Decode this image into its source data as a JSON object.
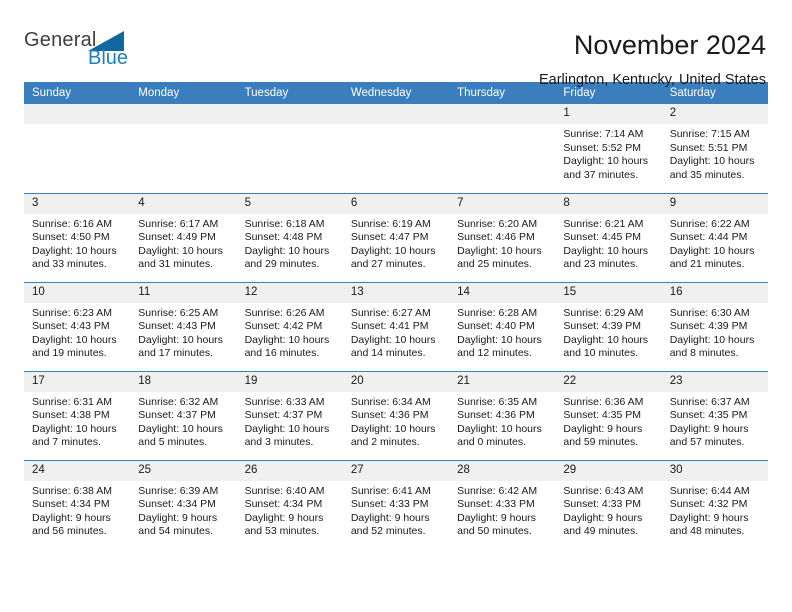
{
  "logo": {
    "word_top": "General",
    "word_bottom": "Blue",
    "mark": "blue-triangle-flag",
    "color_top": "#3f3f3f",
    "color_bottom": "#1b7fc4"
  },
  "header": {
    "month_title": "November 2024",
    "location": "Earlington, Kentucky, United States"
  },
  "theme": {
    "header_blue": "#3b7ebe",
    "daynum_gray": "#f0f0f0",
    "text": "#1a1a1a"
  },
  "weekday_headers": [
    "Sunday",
    "Monday",
    "Tuesday",
    "Wednesday",
    "Thursday",
    "Friday",
    "Saturday"
  ],
  "weeks": [
    [
      {
        "day": "",
        "sunrise": "",
        "sunset": "",
        "daylight": ""
      },
      {
        "day": "",
        "sunrise": "",
        "sunset": "",
        "daylight": ""
      },
      {
        "day": "",
        "sunrise": "",
        "sunset": "",
        "daylight": ""
      },
      {
        "day": "",
        "sunrise": "",
        "sunset": "",
        "daylight": ""
      },
      {
        "day": "",
        "sunrise": "",
        "sunset": "",
        "daylight": ""
      },
      {
        "day": "1",
        "sunrise": "Sunrise: 7:14 AM",
        "sunset": "Sunset: 5:52 PM",
        "daylight": "Daylight: 10 hours and 37 minutes."
      },
      {
        "day": "2",
        "sunrise": "Sunrise: 7:15 AM",
        "sunset": "Sunset: 5:51 PM",
        "daylight": "Daylight: 10 hours and 35 minutes."
      }
    ],
    [
      {
        "day": "3",
        "sunrise": "Sunrise: 6:16 AM",
        "sunset": "Sunset: 4:50 PM",
        "daylight": "Daylight: 10 hours and 33 minutes."
      },
      {
        "day": "4",
        "sunrise": "Sunrise: 6:17 AM",
        "sunset": "Sunset: 4:49 PM",
        "daylight": "Daylight: 10 hours and 31 minutes."
      },
      {
        "day": "5",
        "sunrise": "Sunrise: 6:18 AM",
        "sunset": "Sunset: 4:48 PM",
        "daylight": "Daylight: 10 hours and 29 minutes."
      },
      {
        "day": "6",
        "sunrise": "Sunrise: 6:19 AM",
        "sunset": "Sunset: 4:47 PM",
        "daylight": "Daylight: 10 hours and 27 minutes."
      },
      {
        "day": "7",
        "sunrise": "Sunrise: 6:20 AM",
        "sunset": "Sunset: 4:46 PM",
        "daylight": "Daylight: 10 hours and 25 minutes."
      },
      {
        "day": "8",
        "sunrise": "Sunrise: 6:21 AM",
        "sunset": "Sunset: 4:45 PM",
        "daylight": "Daylight: 10 hours and 23 minutes."
      },
      {
        "day": "9",
        "sunrise": "Sunrise: 6:22 AM",
        "sunset": "Sunset: 4:44 PM",
        "daylight": "Daylight: 10 hours and 21 minutes."
      }
    ],
    [
      {
        "day": "10",
        "sunrise": "Sunrise: 6:23 AM",
        "sunset": "Sunset: 4:43 PM",
        "daylight": "Daylight: 10 hours and 19 minutes."
      },
      {
        "day": "11",
        "sunrise": "Sunrise: 6:25 AM",
        "sunset": "Sunset: 4:43 PM",
        "daylight": "Daylight: 10 hours and 17 minutes."
      },
      {
        "day": "12",
        "sunrise": "Sunrise: 6:26 AM",
        "sunset": "Sunset: 4:42 PM",
        "daylight": "Daylight: 10 hours and 16 minutes."
      },
      {
        "day": "13",
        "sunrise": "Sunrise: 6:27 AM",
        "sunset": "Sunset: 4:41 PM",
        "daylight": "Daylight: 10 hours and 14 minutes."
      },
      {
        "day": "14",
        "sunrise": "Sunrise: 6:28 AM",
        "sunset": "Sunset: 4:40 PM",
        "daylight": "Daylight: 10 hours and 12 minutes."
      },
      {
        "day": "15",
        "sunrise": "Sunrise: 6:29 AM",
        "sunset": "Sunset: 4:39 PM",
        "daylight": "Daylight: 10 hours and 10 minutes."
      },
      {
        "day": "16",
        "sunrise": "Sunrise: 6:30 AM",
        "sunset": "Sunset: 4:39 PM",
        "daylight": "Daylight: 10 hours and 8 minutes."
      }
    ],
    [
      {
        "day": "17",
        "sunrise": "Sunrise: 6:31 AM",
        "sunset": "Sunset: 4:38 PM",
        "daylight": "Daylight: 10 hours and 7 minutes."
      },
      {
        "day": "18",
        "sunrise": "Sunrise: 6:32 AM",
        "sunset": "Sunset: 4:37 PM",
        "daylight": "Daylight: 10 hours and 5 minutes."
      },
      {
        "day": "19",
        "sunrise": "Sunrise: 6:33 AM",
        "sunset": "Sunset: 4:37 PM",
        "daylight": "Daylight: 10 hours and 3 minutes."
      },
      {
        "day": "20",
        "sunrise": "Sunrise: 6:34 AM",
        "sunset": "Sunset: 4:36 PM",
        "daylight": "Daylight: 10 hours and 2 minutes."
      },
      {
        "day": "21",
        "sunrise": "Sunrise: 6:35 AM",
        "sunset": "Sunset: 4:36 PM",
        "daylight": "Daylight: 10 hours and 0 minutes."
      },
      {
        "day": "22",
        "sunrise": "Sunrise: 6:36 AM",
        "sunset": "Sunset: 4:35 PM",
        "daylight": "Daylight: 9 hours and 59 minutes."
      },
      {
        "day": "23",
        "sunrise": "Sunrise: 6:37 AM",
        "sunset": "Sunset: 4:35 PM",
        "daylight": "Daylight: 9 hours and 57 minutes."
      }
    ],
    [
      {
        "day": "24",
        "sunrise": "Sunrise: 6:38 AM",
        "sunset": "Sunset: 4:34 PM",
        "daylight": "Daylight: 9 hours and 56 minutes."
      },
      {
        "day": "25",
        "sunrise": "Sunrise: 6:39 AM",
        "sunset": "Sunset: 4:34 PM",
        "daylight": "Daylight: 9 hours and 54 minutes."
      },
      {
        "day": "26",
        "sunrise": "Sunrise: 6:40 AM",
        "sunset": "Sunset: 4:34 PM",
        "daylight": "Daylight: 9 hours and 53 minutes."
      },
      {
        "day": "27",
        "sunrise": "Sunrise: 6:41 AM",
        "sunset": "Sunset: 4:33 PM",
        "daylight": "Daylight: 9 hours and 52 minutes."
      },
      {
        "day": "28",
        "sunrise": "Sunrise: 6:42 AM",
        "sunset": "Sunset: 4:33 PM",
        "daylight": "Daylight: 9 hours and 50 minutes."
      },
      {
        "day": "29",
        "sunrise": "Sunrise: 6:43 AM",
        "sunset": "Sunset: 4:33 PM",
        "daylight": "Daylight: 9 hours and 49 minutes."
      },
      {
        "day": "30",
        "sunrise": "Sunrise: 6:44 AM",
        "sunset": "Sunset: 4:32 PM",
        "daylight": "Daylight: 9 hours and 48 minutes."
      }
    ]
  ]
}
